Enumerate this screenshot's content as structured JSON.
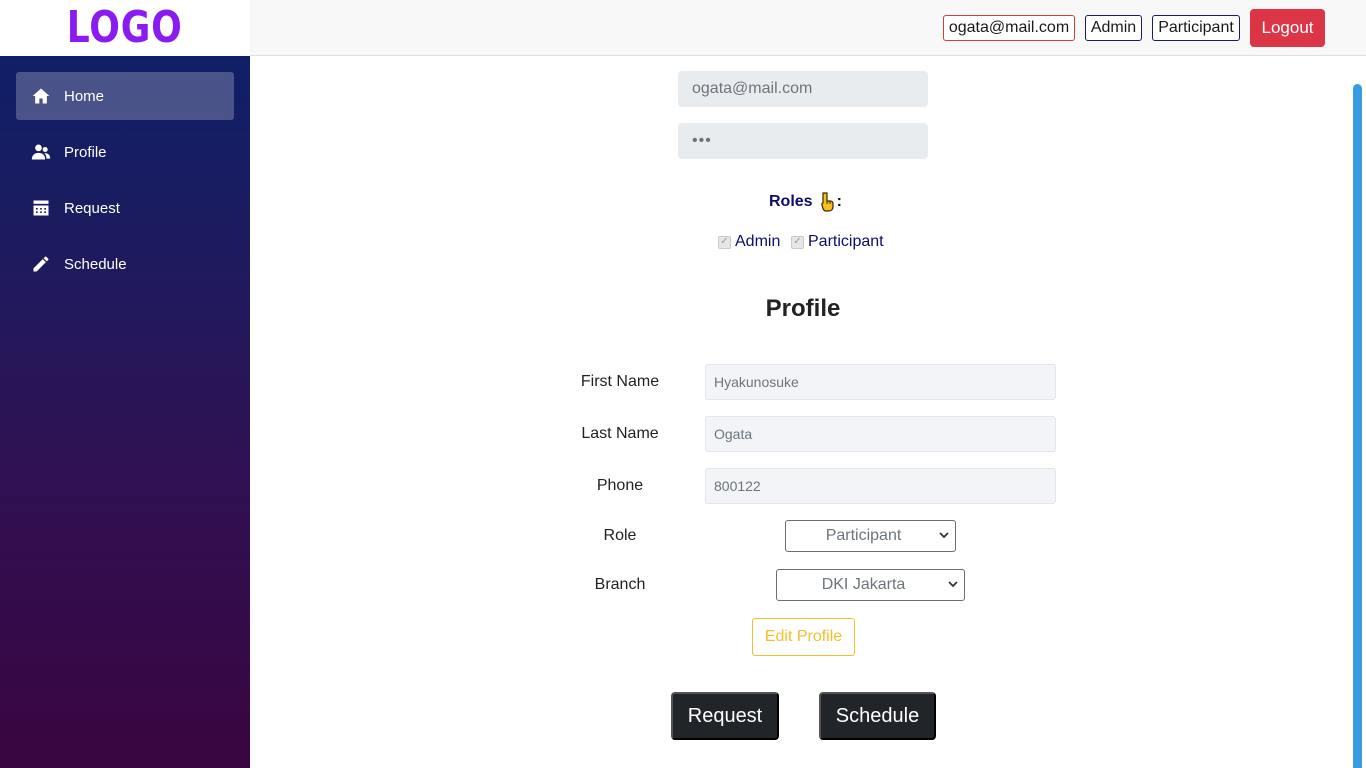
{
  "logo": {
    "text": "LOGO",
    "color": "#8a1cf2"
  },
  "sidebar": {
    "items": [
      {
        "label": "Home",
        "icon": "home-icon",
        "active": true
      },
      {
        "label": "Profile",
        "icon": "users-icon",
        "active": false
      },
      {
        "label": "Request",
        "icon": "calendar-icon",
        "active": false
      },
      {
        "label": "Schedule",
        "icon": "pencil-icon",
        "active": false
      }
    ]
  },
  "header": {
    "email": "ogata@mail.com",
    "admin_badge": "Admin",
    "participant_badge": "Participant",
    "logout_label": "Logout",
    "logout_color": "#dc3545"
  },
  "account": {
    "email_value": "ogata@mail.com",
    "password_value": "•••"
  },
  "roles": {
    "label": "Roles",
    "hand_icon": "hand-pointing-down-icon",
    "colon": ":",
    "options": [
      {
        "label": "Admin",
        "checked": true
      },
      {
        "label": "Participant",
        "checked": true
      }
    ]
  },
  "profile": {
    "title": "Profile",
    "first_name_label": "First Name",
    "first_name_value": "Hyakunosuke",
    "last_name_label": "Last Name",
    "last_name_value": "Ogata",
    "phone_label": "Phone",
    "phone_value": "800122",
    "role_label": "Role",
    "role_value": "Participant",
    "branch_label": "Branch",
    "branch_value": "DKI Jakarta",
    "edit_label": "Edit Profile",
    "edit_color": "#f2bf2b"
  },
  "actions": {
    "request_label": "Request",
    "schedule_label": "Schedule"
  }
}
